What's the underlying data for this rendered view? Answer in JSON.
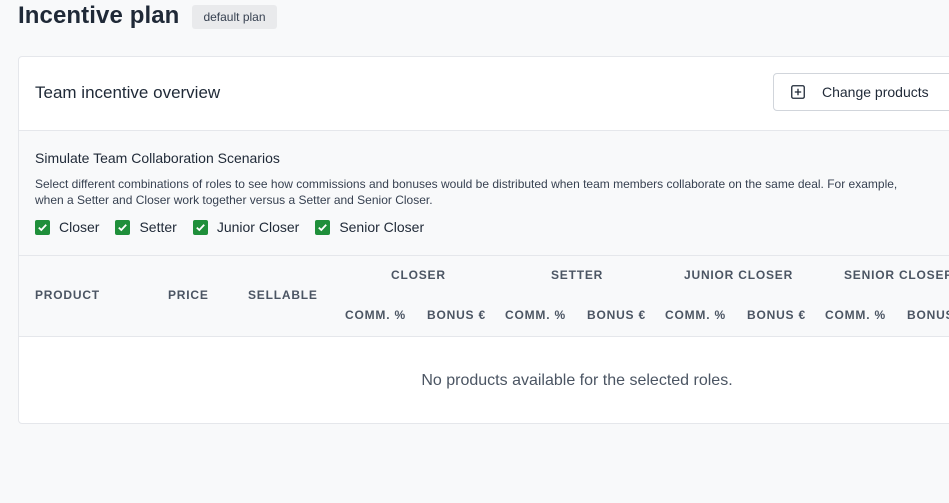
{
  "header": {
    "title": "Incentive plan",
    "badge": "default plan"
  },
  "card": {
    "title": "Team incentive overview",
    "change_products_label": "Change products"
  },
  "simulation": {
    "title": "Simulate Team Collaboration Scenarios",
    "description_line1": "Select different combinations of roles to see how commissions and bonuses would be distributed when team members collaborate on the same deal. For example,",
    "description_line2": "when a Setter and Closer work together versus a Setter and Senior Closer.",
    "roles": [
      {
        "label": "Closer",
        "checked": true
      },
      {
        "label": "Setter",
        "checked": true
      },
      {
        "label": "Junior Closer",
        "checked": true
      },
      {
        "label": "Senior Closer",
        "checked": true
      }
    ]
  },
  "table": {
    "columns": {
      "product": "PRODUCT",
      "price": "PRICE",
      "sellable": "SELLABLE"
    },
    "groups": [
      {
        "label": "CLOSER",
        "comm": "COMM. %",
        "bonus": "BONUS €"
      },
      {
        "label": "SETTER",
        "comm": "COMM. %",
        "bonus": "BONUS €"
      },
      {
        "label": "JUNIOR CLOSER",
        "comm": "COMM. %",
        "bonus": "BONUS €"
      },
      {
        "label": "SENIOR CLOSER",
        "comm": "COMM. %",
        "bonus": "BONUS €"
      }
    ],
    "empty_message": "No products available for the selected roles."
  },
  "colors": {
    "checkbox": "#1f8f3a",
    "background": "#f8f9fa"
  }
}
